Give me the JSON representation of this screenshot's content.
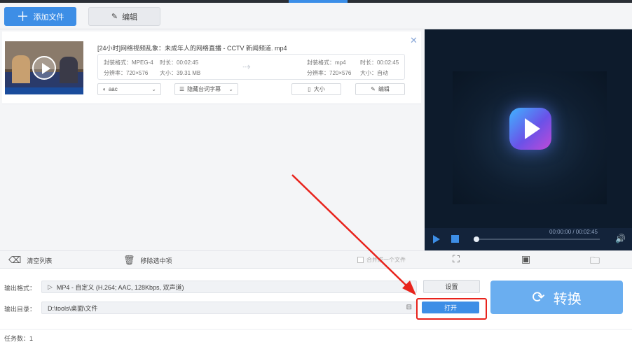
{
  "toolbar": {
    "add_file_label": "添加文件",
    "edit_label": "编辑"
  },
  "file": {
    "title": "[24小时]网络视频乱象：未成年人的网络直播 - CCTV 新闻频道. mp4",
    "source": {
      "format_label": "封装格式：MPEG-4",
      "duration_label": "时长：00:02:45",
      "resolution_label": "分辨率：720×576",
      "size_label": "大小：39.31 MB"
    },
    "output": {
      "format_label": "封装格式：mp4",
      "duration_label": "时长：00:02:45",
      "resolution_label": "分辨率：720×576",
      "size_label": "大小：自动"
    },
    "audio_track": "aac",
    "subtitle": "隐藏台词字幕",
    "size_button": "大小",
    "edit_button": "编辑"
  },
  "preview": {
    "time_display": "00:00:00 / 00:02:45",
    "progress": 0
  },
  "actions": {
    "clear_list": "清空列表",
    "remove_selected": "移除选中项",
    "merge_label": "合并成一个文件"
  },
  "output": {
    "format_label": "输出格式：",
    "format_value": "MP4 - 自定义 (H.264; AAC, 128Kbps, 双声道)",
    "dir_label": "输出目录：",
    "dir_value": "D:\\tools\\桌面\\文件",
    "settings_button": "设置",
    "open_button": "打开",
    "convert_button": "转换"
  },
  "status": {
    "task_count": "任务数：1"
  },
  "colors": {
    "accent": "#3d8ee6",
    "convert": "#6aaef0",
    "annotation": "#e8231c"
  }
}
